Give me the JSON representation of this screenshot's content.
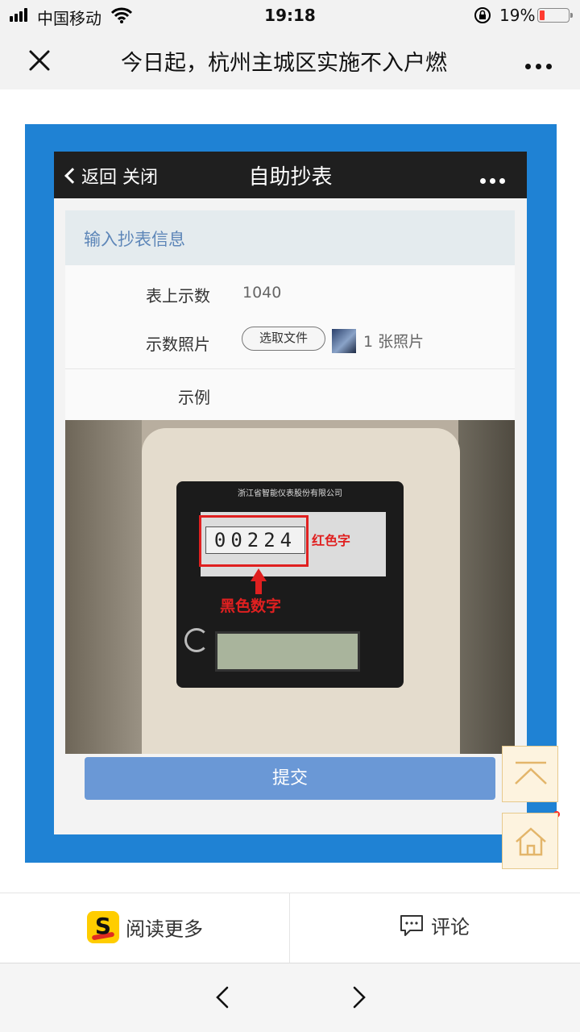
{
  "status_bar": {
    "carrier": "中国移动",
    "time": "19:18",
    "battery_percent": "19%",
    "battery_level": 0.19,
    "signal_icon": "signal-bars-icon",
    "wifi_icon": "wifi-icon",
    "lock_icon": "rotation-lock-icon"
  },
  "nav": {
    "close_icon": "close-icon",
    "title": "今日起，杭州主城区实施不入户燃",
    "more_icon": "more-icon"
  },
  "article_image": {
    "frame_color": "#1f82d4",
    "inner_nav": {
      "back_label": "返回",
      "close_label": "关闭",
      "title": "自助抄表",
      "more_icon": "more-icon"
    },
    "section_title": "输入抄表信息",
    "form": {
      "reading_label": "表上示数",
      "reading_value": "1040",
      "photo_label": "示数照片",
      "choose_file_label": "选取文件",
      "photo_count": "1 张照片",
      "example_label": "示例"
    },
    "meter_photo": {
      "digits": "00224",
      "red_side_label": "红色字",
      "red_caption": "黑色数字"
    },
    "submit_label": "提交"
  },
  "floating": {
    "top_icon": "back-to-top-icon",
    "home_icon": "home-icon"
  },
  "actions": {
    "read_more": "阅读更多",
    "comment": "评论",
    "read_logo_icon": "reader-app-logo",
    "comment_icon": "comment-icon"
  },
  "bottom_nav": {
    "prev_icon": "chevron-left-icon",
    "next_icon": "chevron-right-icon"
  }
}
